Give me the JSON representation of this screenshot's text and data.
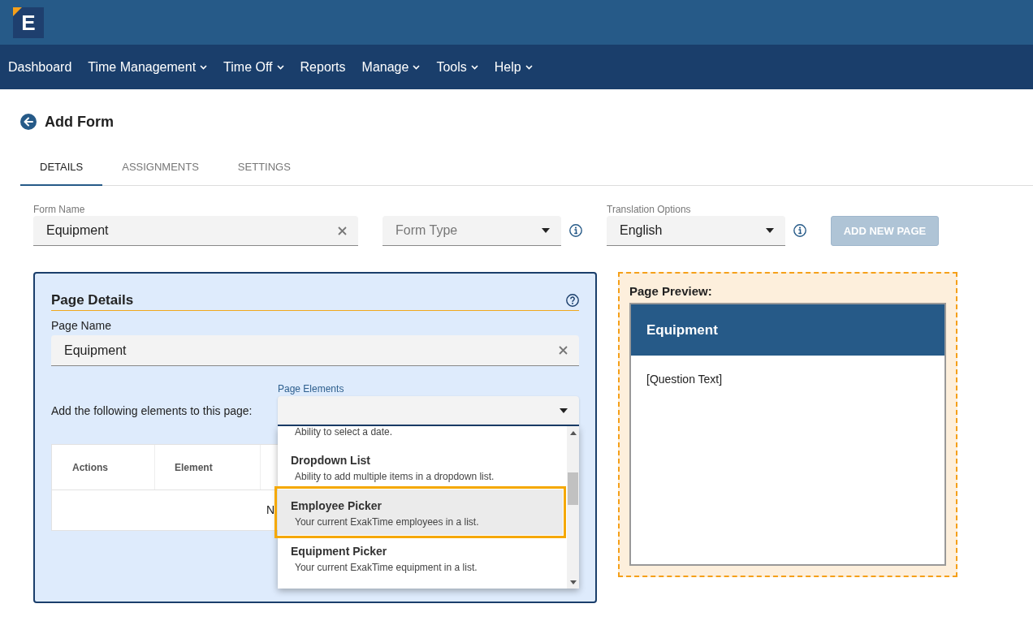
{
  "logo": {
    "text": "E"
  },
  "nav": [
    {
      "label": "Dashboard",
      "has_menu": false
    },
    {
      "label": "Time Management",
      "has_menu": true
    },
    {
      "label": "Time Off",
      "has_menu": true
    },
    {
      "label": "Reports",
      "has_menu": false
    },
    {
      "label": "Manage",
      "has_menu": true
    },
    {
      "label": "Tools",
      "has_menu": true
    },
    {
      "label": "Help",
      "has_menu": true
    }
  ],
  "page": {
    "title": "Add Form"
  },
  "tabs": [
    {
      "label": "DETAILS",
      "selected": true
    },
    {
      "label": "ASSIGNMENTS",
      "selected": false
    },
    {
      "label": "SETTINGS",
      "selected": false
    }
  ],
  "form": {
    "form_name": {
      "label": "Form Name",
      "value": "Equipment"
    },
    "form_type": {
      "placeholder": "Form Type"
    },
    "translation": {
      "label": "Translation Options",
      "value": "English"
    },
    "add_button": {
      "label": "ADD NEW PAGE",
      "disabled": true
    }
  },
  "page_details": {
    "title": "Page Details",
    "page_name": {
      "label": "Page Name",
      "value": "Equipment"
    },
    "elements_prompt": "Add the following elements to this page:",
    "page_elements": {
      "label": "Page Elements",
      "expanded": true,
      "options": [
        {
          "description": "Ability to select a date.",
          "selected": false
        },
        {
          "title": "Dropdown List",
          "description": "Ability to add multiple items in a dropdown list.",
          "selected": false
        },
        {
          "title": "Employee Picker",
          "description": "Your current ExakTime employees in a list.",
          "selected": true
        },
        {
          "title": "Equipment Picker",
          "description": "Your current ExakTime equipment in a list.",
          "selected": false
        }
      ]
    },
    "table": {
      "columns": [
        "Actions",
        "Element"
      ],
      "empty_text": "N"
    }
  },
  "preview": {
    "title": "Page Preview:",
    "page_title": "Equipment",
    "question": "[Question Text]"
  }
}
